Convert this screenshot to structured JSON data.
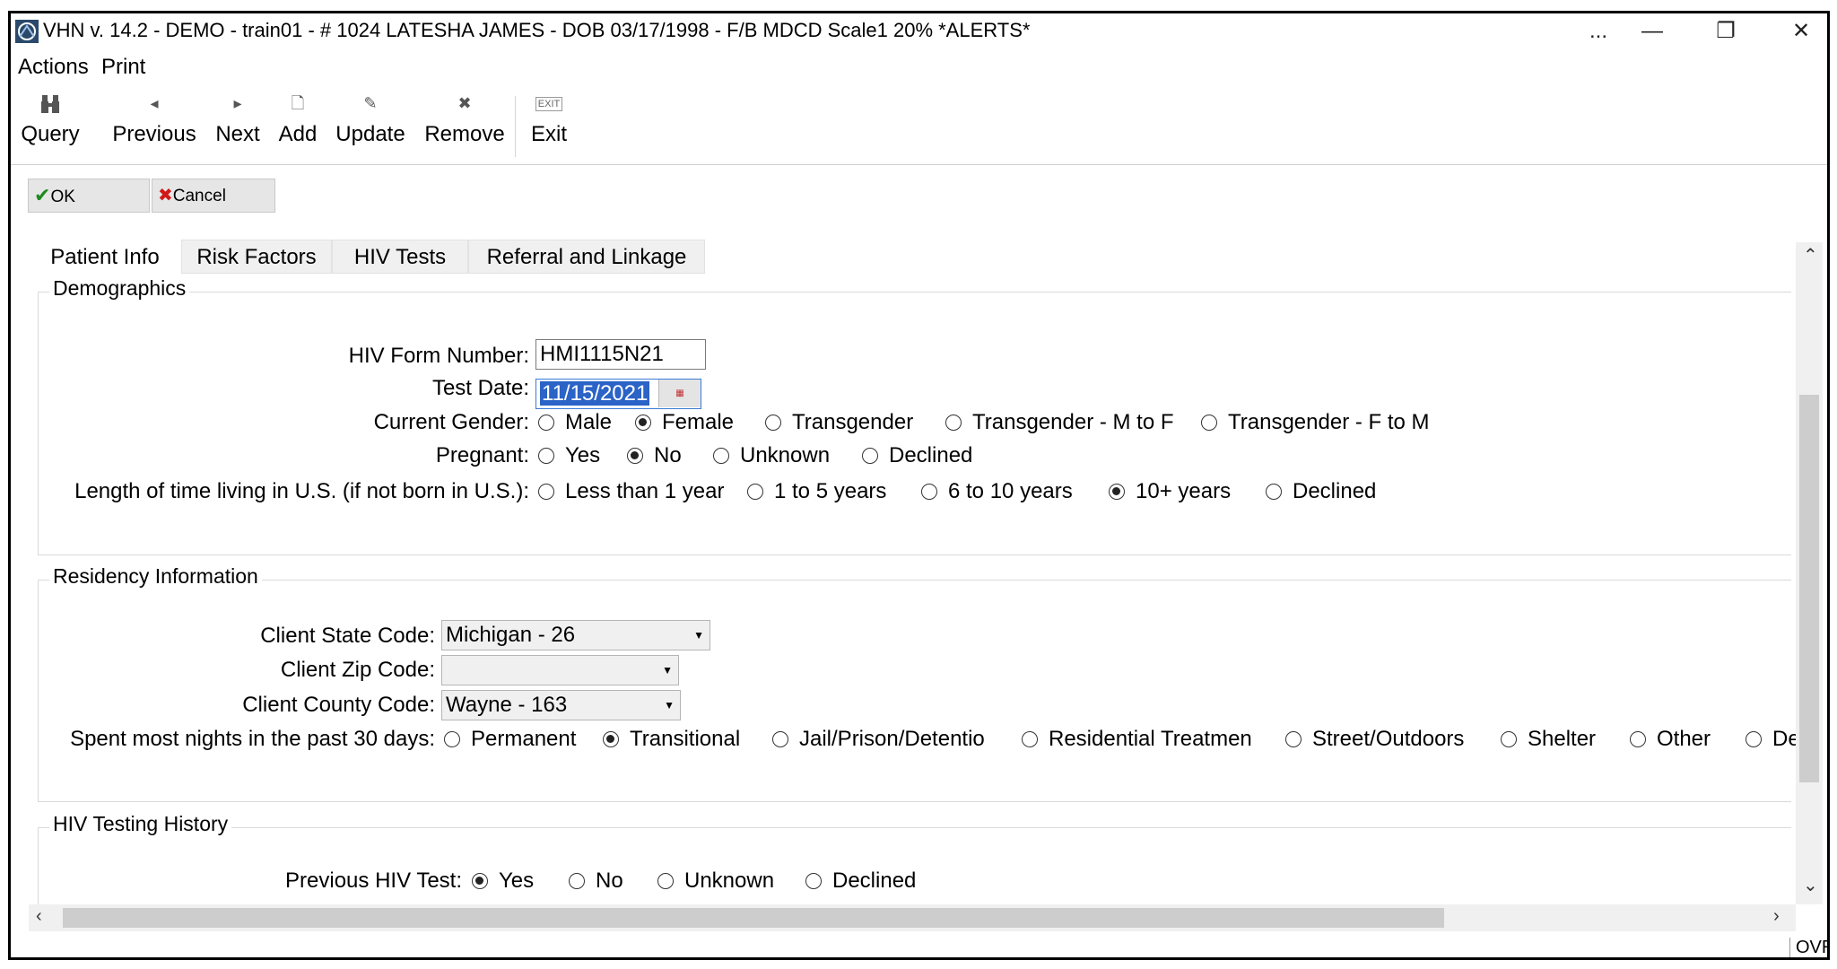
{
  "window": {
    "title": "VHN v. 14.2 - DEMO - train01 - # 1024  LATESHA JAMES - DOB 03/17/1998 - F/B MDCD  Scale1  20% *ALERTS*",
    "more": "...",
    "minimize": "—",
    "restore": "❐",
    "close": "✕"
  },
  "menu": {
    "actions": "Actions",
    "print": "Print"
  },
  "toolbar": {
    "query": "Query",
    "previous": "Previous",
    "next": "Next",
    "add": "Add",
    "update": "Update",
    "remove": "Remove",
    "exit": "Exit",
    "exit_icon_text": "EXIT"
  },
  "buttons": {
    "ok": "OK",
    "cancel": "Cancel"
  },
  "tabs": [
    "Patient Info",
    "Risk Factors",
    "HIV Tests",
    "Referral and Linkage"
  ],
  "demographics": {
    "legend": "Demographics",
    "form_number_label": "HIV Form Number:",
    "form_number_value": "HMI1115N21",
    "test_date_label": "Test Date:",
    "test_date_value": "11/15/2021",
    "gender_label": "Current Gender:",
    "gender_options": [
      "Male",
      "Female",
      "Transgender",
      "Transgender - M to F",
      "Transgender - F to M"
    ],
    "pregnant_label": "Pregnant:",
    "pregnant_options": [
      "Yes",
      "No",
      "Unknown",
      "Declined"
    ],
    "length_label": "Length of time living in U.S. (if not born in U.S.):",
    "length_options": [
      "Less than 1 year",
      "1 to 5 years",
      "6 to 10 years",
      "10+ years",
      "Declined"
    ]
  },
  "residency": {
    "legend": "Residency Information",
    "state_label": "Client State Code:",
    "state_value": "Michigan - 26",
    "zip_label": "Client Zip Code:",
    "zip_value": "",
    "county_label": "Client County Code:",
    "county_value": "Wayne - 163",
    "nights_label": "Spent most nights in the past 30 days:",
    "nights_options": [
      "Permanent",
      "Transitional",
      "Jail/Prison/Detentio",
      "Residential Treatmen",
      "Street/Outdoors",
      "Shelter",
      "Other",
      "De"
    ]
  },
  "history": {
    "legend": "HIV Testing History",
    "prev_label": "Previous HIV Test:",
    "prev_options": [
      "Yes",
      "No",
      "Unknown",
      "Declined"
    ]
  },
  "status": {
    "ovr": "OVR"
  }
}
